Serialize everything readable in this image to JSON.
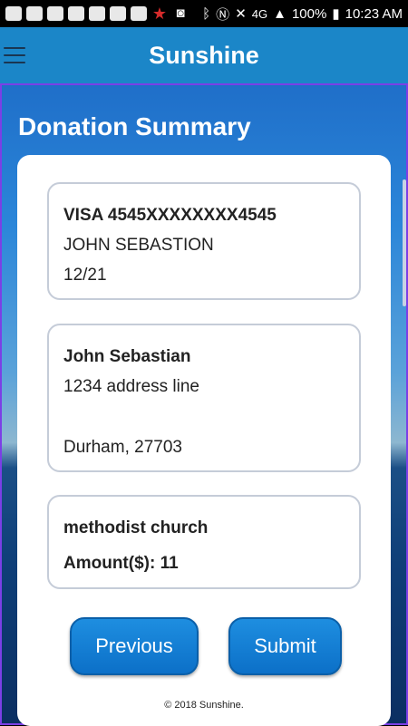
{
  "status_bar": {
    "battery": "100%",
    "time": "10:23 AM",
    "network": "4G",
    "icons": [
      "messages-icon",
      "wallet-icon",
      "wallet-icon",
      "tag-icon",
      "mail-icon",
      "notes-icon",
      "flipboard-icon",
      "star-icon",
      "camera-icon",
      "bluetooth-icon",
      "nfc-icon",
      "mute-icon",
      "signal-icon",
      "battery-icon"
    ]
  },
  "app": {
    "title": "Sunshine",
    "menu_icon": "hamburger-menu-icon",
    "accent_color": "#1b86c8"
  },
  "page": {
    "title": "Donation Summary"
  },
  "payment": {
    "card": "VISA 4545XXXXXXXX4545",
    "name": "JOHN SEBASTION",
    "expiry": "12/21"
  },
  "address": {
    "name": "John Sebastian",
    "line1": "1234 address line",
    "city_zip": "Durham, 27703"
  },
  "donation": {
    "recipient": "methodist church",
    "amount_label": "Amount($): 11"
  },
  "buttons": {
    "previous": "Previous",
    "submit": "Submit"
  },
  "footer": {
    "copyright": "© 2018 Sunshine."
  }
}
